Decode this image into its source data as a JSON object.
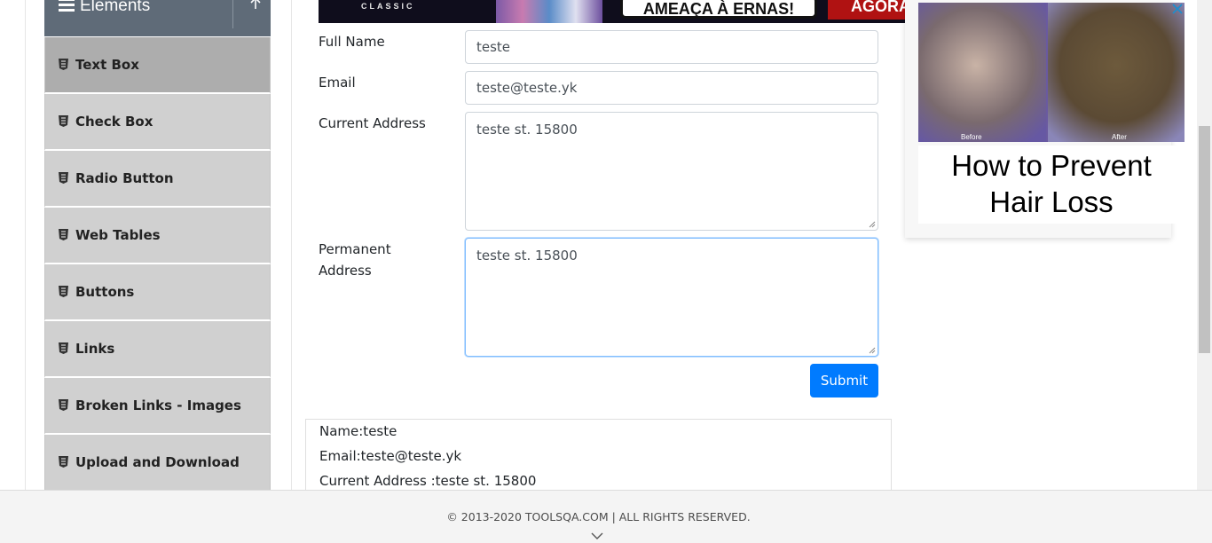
{
  "sidebar": {
    "group_title": "Elements",
    "items": [
      {
        "label": "Text Box",
        "active": true
      },
      {
        "label": "Check Box"
      },
      {
        "label": "Radio Button"
      },
      {
        "label": "Web Tables"
      },
      {
        "label": "Buttons"
      },
      {
        "label": "Links"
      },
      {
        "label": "Broken Links - Images"
      },
      {
        "label": "Upload and Download"
      }
    ]
  },
  "banner": {
    "classic": "CLASSIC",
    "slogan": "AMEAÇA À ERNAS!",
    "cta": "AGORA"
  },
  "form": {
    "full_name_label": "Full Name",
    "full_name_value": "teste",
    "email_label": "Email",
    "email_value": "teste@teste.yk",
    "current_address_label": "Current Address",
    "current_address_value": "teste st. 15800",
    "permanent_address_label_1": "Permanent",
    "permanent_address_label_2": "Address",
    "permanent_address_value": "teste st. 15800",
    "submit_label": "Submit"
  },
  "output": {
    "name": "Name:teste",
    "email": "Email:teste@teste.yk",
    "current_address": "Current Address :teste st. 15800"
  },
  "ad": {
    "before_caption": "Before",
    "after_caption": "After",
    "headline_1": "How to Prevent",
    "headline_2": "Hair Loss"
  },
  "footer": {
    "copyright": "© 2013-2020 TOOLSQA.COM | ALL RIGHTS RESERVED."
  },
  "colors": {
    "accent": "#007bff",
    "sidebar_header": "#5f6b78",
    "sidebar_item": "#d0d0d0",
    "sidebar_item_active": "#adadad"
  }
}
